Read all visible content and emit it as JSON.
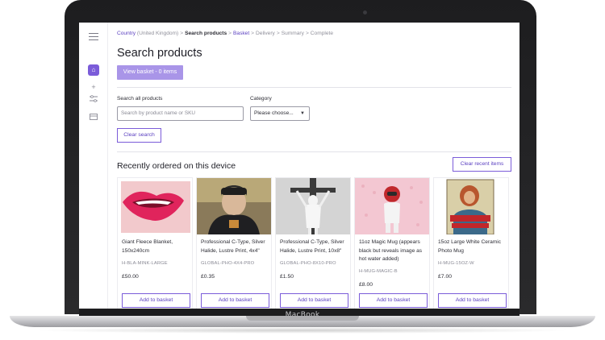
{
  "device": {
    "brand": "MacBook"
  },
  "breadcrumb": [
    {
      "label": "Country",
      "extra": " (United Kingdom)",
      "state": "link"
    },
    {
      "label": "Search products",
      "state": "current"
    },
    {
      "label": "Basket",
      "state": "link"
    },
    {
      "label": "Delivery",
      "state": "future"
    },
    {
      "label": "Summary",
      "state": "future"
    },
    {
      "label": "Complete",
      "state": "future"
    }
  ],
  "breadcrumb_separator": ">",
  "page": {
    "title": "Search products",
    "view_basket_label": "View basket - 0 items"
  },
  "search": {
    "label": "Search all products",
    "placeholder": "Search by product name or SKU",
    "category_label": "Category",
    "category_value": "Please choose...",
    "clear_label": "Clear search"
  },
  "recent": {
    "title": "Recently ordered on this device",
    "clear_label": "Clear recent items",
    "add_label": "Add to basket",
    "products": [
      {
        "name": "Giant Fleece Blanket, 150x240cm",
        "sku": "H-BLA-MINK-LARGE",
        "price": "£50.00",
        "image": "lips-illustration"
      },
      {
        "name": "Professional C-Type, Silver Halide, Lustre Print, 4x4\"",
        "sku": "GLOBAL-PHO-4X4-PRO",
        "price": "£0.35",
        "image": "portrait-photo"
      },
      {
        "name": "Professional C-Type, Silver Halide, Lustre Print, 10x8\"",
        "sku": "GLOBAL-PHO-8X10-PRO",
        "price": "£1.50",
        "image": "black-white-photo"
      },
      {
        "name": "11oz Magic Mug (appears black but reveals image as hot water added)",
        "sku": "H-MUG-MAGIC-B",
        "price": "£8.00",
        "image": "astronaut-photo"
      },
      {
        "name": "15oz Large White Ceramic Photo Mug",
        "sku": "H-MUG-15OZ-W",
        "price": "£7.00",
        "image": "poster-illustration"
      }
    ]
  },
  "colors": {
    "accent": "#7b5cd9",
    "accent_light": "#a995e8",
    "link": "#5a3fc0"
  }
}
